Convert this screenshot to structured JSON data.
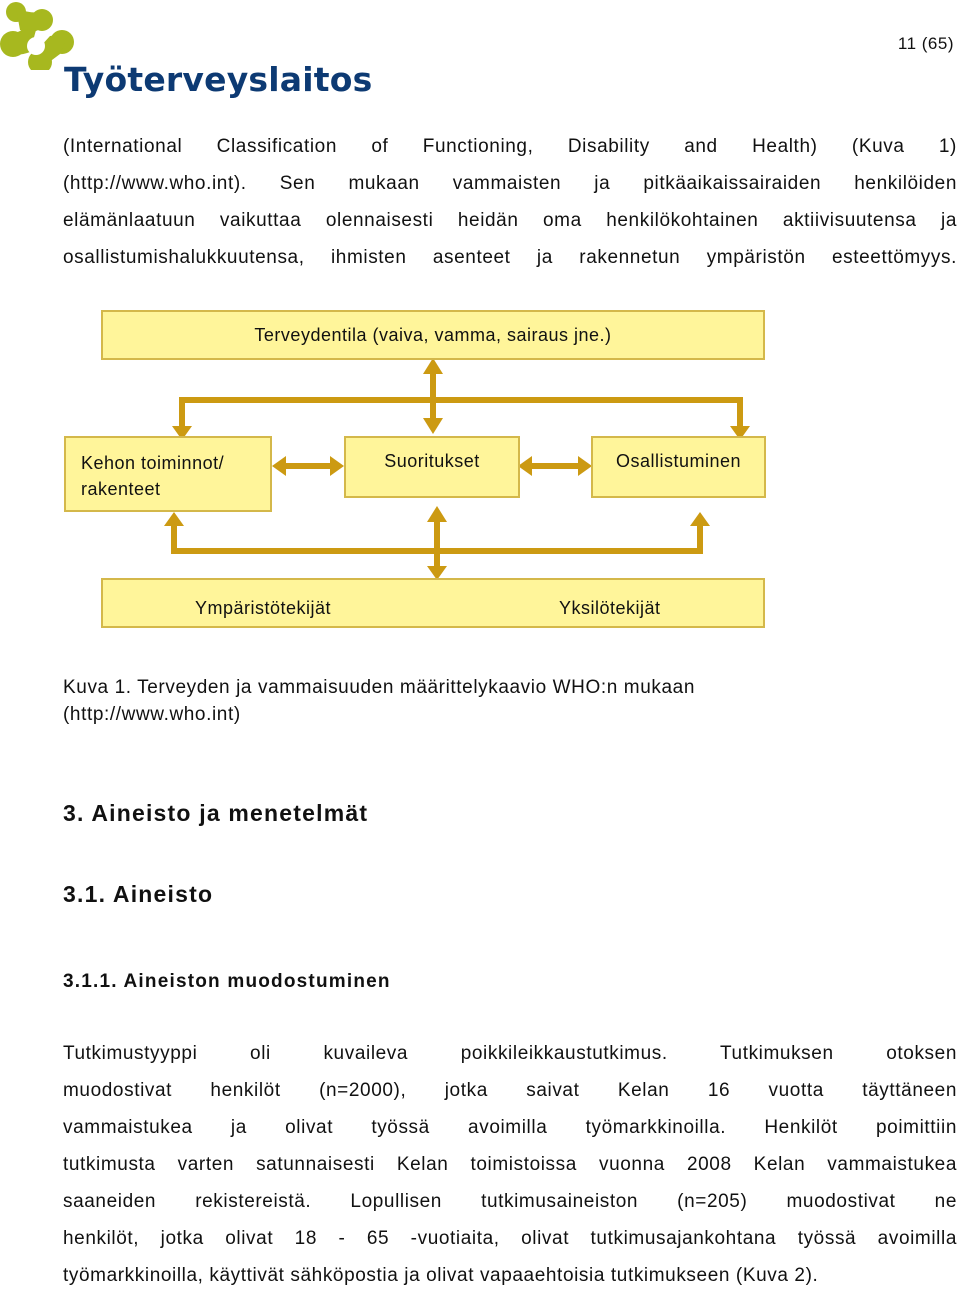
{
  "header": {
    "logo_text": "Työterveyslaitos",
    "logo_icon": "molecule-logo-icon",
    "page_number": "11 (65)",
    "colors": {
      "logo_green": "#a7b81f",
      "logo_blue": "#0d3a73"
    }
  },
  "intro_paragraph": {
    "lines": [
      "(International Classification of Functioning, Disability and Health) (Kuva 1)",
      "(http://www.who.int). Sen mukaan vammaisten ja pitkäaikaissairaiden henkilöiden",
      "elämänlaatuun vaikuttaa olennaisesti heidän oma henkilökohtainen aktiivisuutensa ja",
      "osallistumishalukkuutensa, ihmisten asenteet ja rakennetun ympäristön esteettömyys."
    ]
  },
  "diagram": {
    "colors": {
      "box_fill": "#fff59a",
      "box_border": "#d4b84a",
      "arrow": "#cc9a12"
    },
    "top_box": "Terveydentila (vaiva, vamma, sairaus jne.)",
    "middle_boxes": [
      "Kehon toiminnot/",
      "rakenteet",
      "Suoritukset",
      "Osallistuminen"
    ],
    "bottom_box": {
      "left": "Ympäristötekijät",
      "right": "Yksilötekijät"
    }
  },
  "caption": {
    "line1": "Kuva 1. Terveyden ja vammaisuuden määrittelykaavio WHO:n mukaan",
    "line2": "(http://www.who.int)"
  },
  "headings": {
    "h1": "3. Aineisto ja menetelmät",
    "h2": "3.1. Aineisto",
    "h3": "3.1.1. Aineiston muodostuminen"
  },
  "body_paragraph": {
    "lines": [
      "Tutkimustyyppi oli kuvaileva poikkileikkaustutkimus. Tutkimuksen otoksen",
      "muodostivat henkilöt (n=2000), jotka saivat Kelan 16 vuotta täyttäneen",
      "vammaistukea ja olivat työssä avoimilla työmarkkinoilla. Henkilöt poimittiin",
      "tutkimusta varten satunnaisesti Kelan toimistoissa vuonna 2008 Kelan vammaistukea",
      "saaneiden rekistereistä. Lopullisen tutkimusaineiston (n=205) muodostivat ne",
      "henkilöt, jotka olivat 18 - 65 -vuotiaita, olivat tutkimusajankohtana työssä avoimilla",
      "työmarkkinoilla, käyttivät sähköpostia ja olivat vapaaehtoisia tutkimukseen (Kuva 2)."
    ]
  }
}
